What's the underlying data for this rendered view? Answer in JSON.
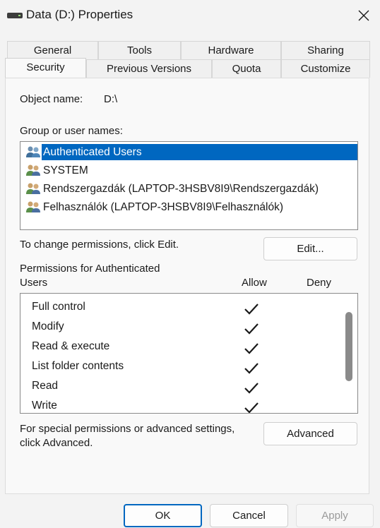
{
  "window": {
    "title": "Data (D:) Properties"
  },
  "tabs_row1": [
    "General",
    "Tools",
    "Hardware",
    "Sharing"
  ],
  "tabs_row2": [
    "Security",
    "Previous Versions",
    "Quota",
    "Customize"
  ],
  "object": {
    "label": "Object name:",
    "value": "D:\\"
  },
  "groups": {
    "label": "Group or user names:",
    "users": [
      "Authenticated Users",
      "SYSTEM",
      "Rendszergazdák (LAPTOP-3HSBV8I9\\Rendszergazdák)",
      "Felhasználók (LAPTOP-3HSBV8I9\\Felhasználók)"
    ]
  },
  "edit": {
    "hint": "To change permissions, click Edit.",
    "button": "Edit..."
  },
  "permissions": {
    "label_line1": "Permissions for Authenticated",
    "label_line2": "Users",
    "allow_header": "Allow",
    "deny_header": "Deny",
    "items": [
      "Full control",
      "Modify",
      "Read & execute",
      "List folder contents",
      "Read",
      "Write"
    ]
  },
  "advanced": {
    "hint_line1": "For special permissions or advanced settings,",
    "hint_line2": "click Advanced.",
    "button": "Advanced"
  },
  "footer": {
    "ok": "OK",
    "cancel": "Cancel",
    "apply": "Apply"
  },
  "colors": {
    "selection": "#0067c0",
    "ok_border": "#0067c0"
  }
}
